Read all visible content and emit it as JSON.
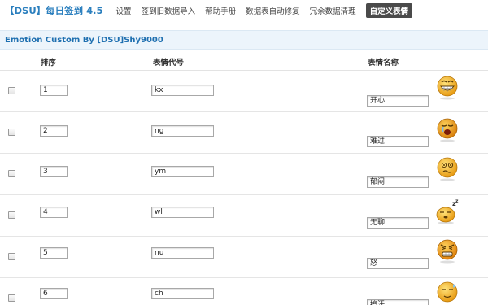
{
  "nav": {
    "brand": "【DSU】每日签到",
    "version": "4.5",
    "links": [
      {
        "label": "设置"
      },
      {
        "label": "签到旧数据导入"
      },
      {
        "label": "帮助手册"
      },
      {
        "label": "数据表自动修复"
      },
      {
        "label": "冗余数据清理"
      },
      {
        "label": "自定义表情",
        "active": true
      }
    ]
  },
  "section": {
    "title": "Emotion Custom By [DSU]Shy9000"
  },
  "table": {
    "headers": {
      "order": "排序",
      "code": "表情代号",
      "name": "表情名称"
    },
    "rows": [
      {
        "order": "1",
        "code": "kx",
        "name": "开心",
        "icon": "happy-grin-icon"
      },
      {
        "order": "2",
        "code": "ng",
        "name": "难过",
        "icon": "sad-crying-icon"
      },
      {
        "order": "3",
        "code": "ym",
        "name": "郁闷",
        "icon": "dizzy-depressed-icon"
      },
      {
        "order": "4",
        "code": "wl",
        "name": "无聊",
        "icon": "bored-sleepy-icon"
      },
      {
        "order": "5",
        "code": "nu",
        "name": "怒",
        "icon": "angry-icon"
      },
      {
        "order": "6",
        "code": "ch",
        "name": "擦汗",
        "icon": "sweat-icon"
      }
    ]
  },
  "colors": {
    "brand": "#2b7fbe",
    "section_bg": "#ecf4fb",
    "section_text": "#1e6fb0",
    "active_tab_bg": "#4a4a4a",
    "smiley": "#f2b51c"
  }
}
